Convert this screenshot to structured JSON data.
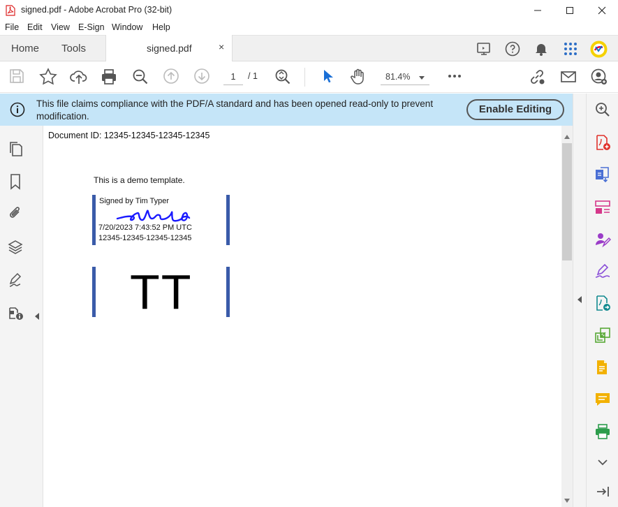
{
  "window": {
    "title": "signed.pdf - Adobe Acrobat Pro (32-bit)"
  },
  "menu": [
    "File",
    "Edit",
    "View",
    "E-Sign",
    "Window",
    "Help"
  ],
  "tabs": {
    "home": "Home",
    "tools": "Tools",
    "document": "signed.pdf",
    "close": "×"
  },
  "toolbar": {
    "page_current": "1",
    "page_total": "/ 1",
    "zoom": "81.4%"
  },
  "banner": {
    "message": "This file claims compliance with the PDF/A standard and has been opened read-only to prevent modification.",
    "button": "Enable Editing"
  },
  "document": {
    "doc_id": "Document ID: 12345-12345-12345-12345",
    "demo_text": "This is a demo template.",
    "signature": {
      "signed_by": "Signed by Tim Typer",
      "date": "7/20/2023 7:43:52 PM UTC",
      "id": "12345-12345-12345-12345"
    },
    "initials": "TT"
  },
  "colors": {
    "banner_bg": "#c5e5f8",
    "signature_bar": "#3a5ba9",
    "scribble": "#1a1aff",
    "acrobat_red": "#e0312b"
  }
}
